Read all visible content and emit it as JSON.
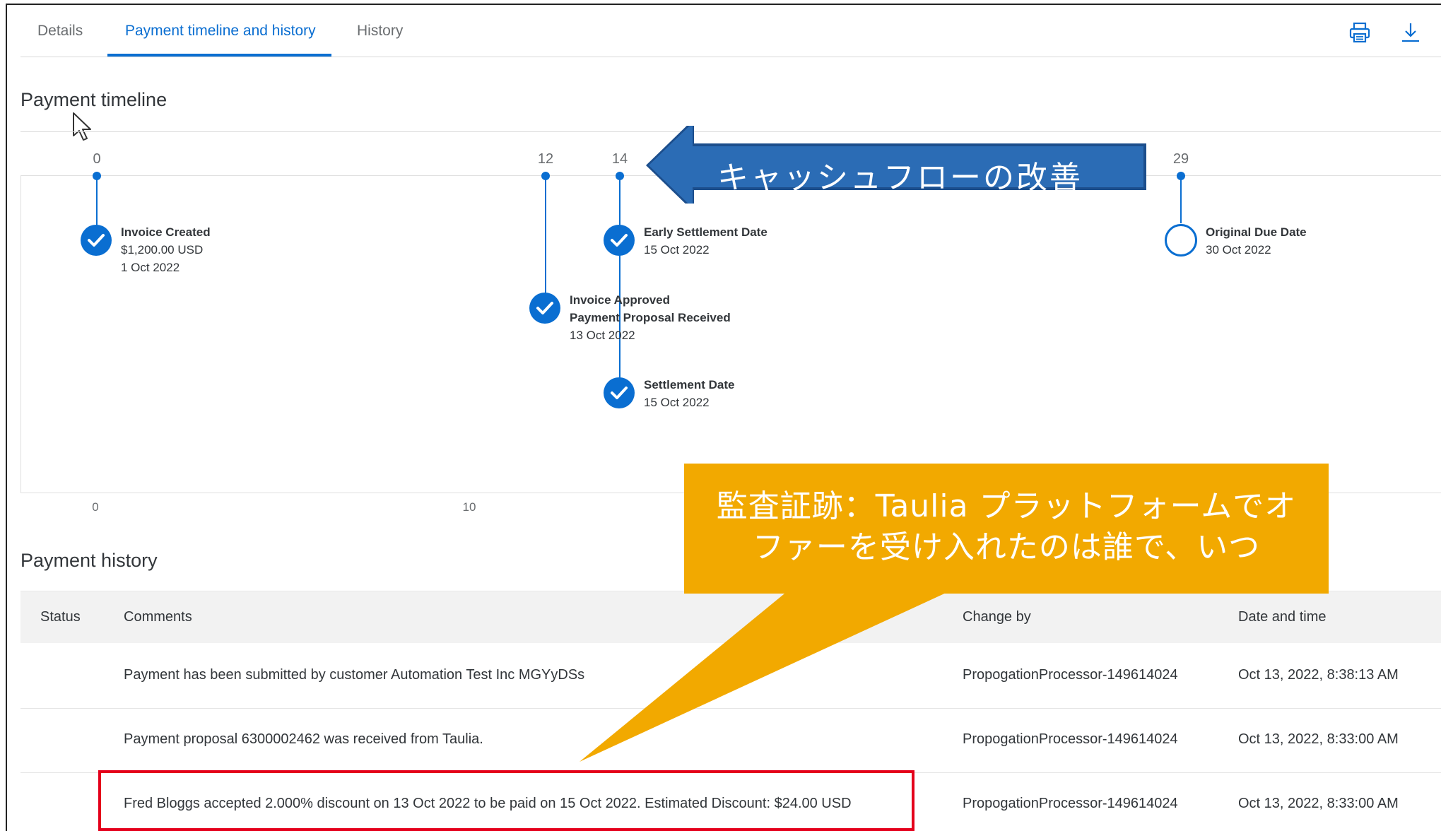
{
  "tabs": [
    {
      "label": "Details"
    },
    {
      "label": "Payment timeline and history"
    },
    {
      "label": "History"
    }
  ],
  "icons": {
    "print": "printer-icon",
    "download": "download-icon"
  },
  "colors": {
    "accent": "#0a6ed1",
    "callout_blue": "#1c4e8c",
    "callout_orange": "#f2a900",
    "highlight_red": "#e4001b"
  },
  "timeline": {
    "title": "Payment timeline",
    "ticks": [
      "0",
      "12",
      "14",
      "29"
    ],
    "axis": [
      "0",
      "10"
    ],
    "events": [
      {
        "title": "Invoice Created",
        "line1": "$1,200.00 USD",
        "line2": "1 Oct 2022",
        "status": "done"
      },
      {
        "title": "Early Settlement Date",
        "line1": "15 Oct 2022",
        "status": "done"
      },
      {
        "title": "Invoice Approved",
        "line1": "Payment Proposal Received",
        "line2": "13 Oct 2022",
        "status": "done"
      },
      {
        "title": "Settlement Date",
        "line1": "15 Oct 2022",
        "status": "done"
      },
      {
        "title": "Original Due Date",
        "line1": "30 Oct 2022",
        "status": "pending"
      }
    ]
  },
  "history": {
    "title": "Payment history",
    "columns": [
      "Status",
      "Comments",
      "Change by",
      "Date and time"
    ],
    "rows": [
      {
        "status": "",
        "comment": "Payment has been submitted by customer Automation Test Inc MGYyDSs",
        "change_by": "PropogationProcessor-149614024",
        "datetime": "Oct 13, 2022, 8:38:13 AM"
      },
      {
        "status": "",
        "comment": "Payment proposal 6300002462 was received from Taulia.",
        "change_by": "PropogationProcessor-149614024",
        "datetime": "Oct 13, 2022, 8:33:00 AM"
      },
      {
        "status": "",
        "comment": "Fred Bloggs accepted 2.000% discount on 13 Oct 2022 to be paid on 15 Oct 2022. Estimated Discount: $24.00 USD",
        "change_by": "PropogationProcessor-149614024",
        "datetime": "Oct 13, 2022, 8:33:00 AM"
      }
    ]
  },
  "annotations": {
    "cashflow": "キャッシュフローの改善",
    "audit_line1": "監査証跡：Taulia プラットフォームでオ",
    "audit_line2": "ファーを受け入れたのは誰で、いつ"
  }
}
